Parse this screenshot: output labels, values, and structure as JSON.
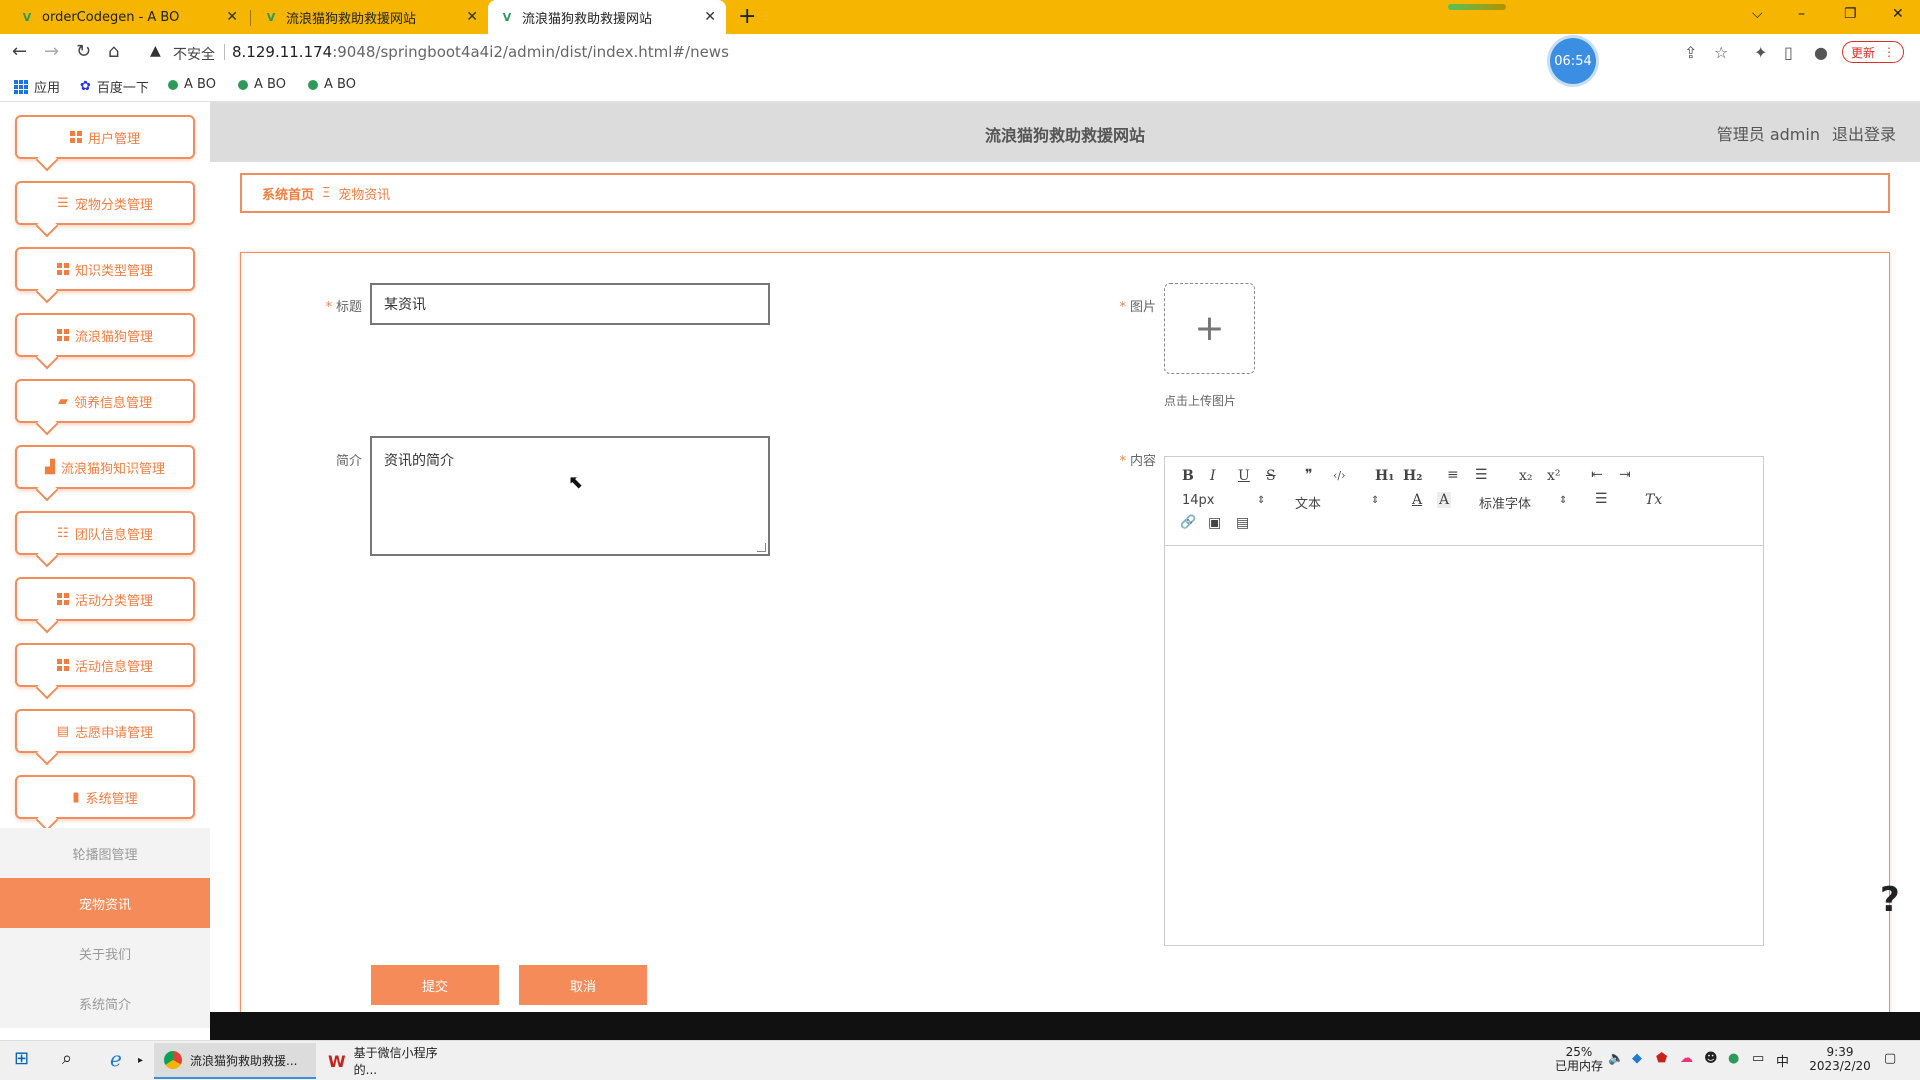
{
  "browser": {
    "tabs": [
      {
        "title": "orderCodegen - A BO",
        "active": false
      },
      {
        "title": "流浪猫狗救助救援网站",
        "active": false
      },
      {
        "title": "流浪猫狗救助救援网站",
        "active": true
      }
    ],
    "new_tab": "+",
    "window_controls": {
      "dropdown": "⌵",
      "minimize": "–",
      "restore": "❐",
      "close": "✕"
    },
    "address": {
      "security_label": "不安全",
      "url_host": "8.129.11.174",
      "url_rest": ":9048/springboot4a4i2/admin/dist/index.html#/news"
    },
    "clock_badge": "06:54",
    "update_label": "更新",
    "bookmarks": [
      {
        "label": "应用"
      },
      {
        "label": "百度一下"
      },
      {
        "label": "A BO"
      },
      {
        "label": "A BO"
      },
      {
        "label": "A BO"
      }
    ]
  },
  "header": {
    "site_title": "流浪猫狗救助救援网站",
    "role_user": "管理员 admin",
    "logout": "退出登录"
  },
  "sidebar": {
    "items": [
      {
        "label": "用户管理",
        "icon": "grid-icon"
      },
      {
        "label": "宠物分类管理",
        "icon": "list-icon"
      },
      {
        "label": "知识类型管理",
        "icon": "grid-icon"
      },
      {
        "label": "流浪猫狗管理",
        "icon": "grid-icon"
      },
      {
        "label": "领养信息管理",
        "icon": "ticket-icon"
      },
      {
        "label": "流浪猫狗知识管理",
        "icon": "chart-icon"
      },
      {
        "label": "团队信息管理",
        "icon": "sliders-icon"
      },
      {
        "label": "活动分类管理",
        "icon": "grid-icon"
      },
      {
        "label": "活动信息管理",
        "icon": "grid-icon"
      },
      {
        "label": "志愿申请管理",
        "icon": "clipboard-icon"
      },
      {
        "label": "系统管理",
        "icon": "bar-chart-icon"
      }
    ],
    "sub_items": [
      {
        "label": "轮播图管理",
        "active": false
      },
      {
        "label": "宠物资讯",
        "active": true
      },
      {
        "label": "关于我们",
        "active": false
      },
      {
        "label": "系统简介",
        "active": false
      }
    ]
  },
  "breadcrumb": {
    "home": "系统首页",
    "separator": "Ξ",
    "current": "宠物资讯"
  },
  "form": {
    "title_label": "标题",
    "title_value": "某资讯",
    "intro_label": "简介",
    "intro_value": "资讯的简介",
    "image_label": "图片",
    "upload_plus": "+",
    "upload_hint": "点击上传图片",
    "content_label": "内容",
    "required_mark": "*",
    "submit_label": "提交",
    "cancel_label": "取消"
  },
  "editor": {
    "bold": "B",
    "italic": "I",
    "underline": "U",
    "strike": "S",
    "quote": "❞",
    "code": "‹/›",
    "h1": "H₁",
    "h2": "H₂",
    "ordered_list": "≡",
    "bullet_list": "☰",
    "subscript": "x₂",
    "superscript": "x²",
    "outdent": "⇤",
    "indent": "⇥",
    "size_value": "14px",
    "paragraph_value": "文本",
    "font_value": "标准字体",
    "color_a": "A",
    "background_a": "A",
    "align": "☰",
    "clear_format": "Tx",
    "link": "🔗",
    "image": "▣",
    "video": "▤"
  },
  "taskbar": {
    "apps": [
      {
        "label": "流浪猫狗救助救援...",
        "active": true
      },
      {
        "label": "基于微信小程序的...",
        "active": false
      }
    ],
    "memory_percent": "25%",
    "memory_label": "已用内存",
    "ime": "中",
    "time": "9:39",
    "date": "2023/2/20"
  },
  "colors": {
    "accent": "#f58b58",
    "accent_text": "#f07e43",
    "browser_frame": "#f5b500",
    "header_bg": "#dcdcdc"
  }
}
